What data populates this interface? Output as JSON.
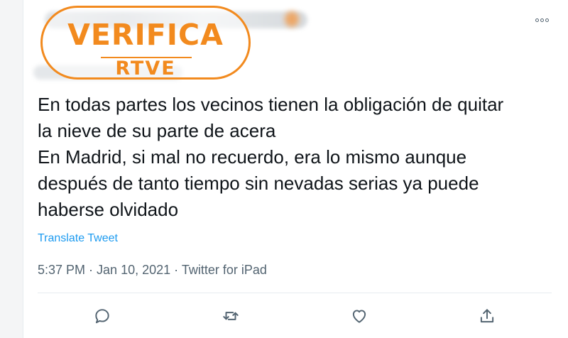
{
  "watermark": {
    "brand": "VERIFICA",
    "sub": "RTVE"
  },
  "tweet": {
    "lines": [
      "En todas partes los vecinos tienen la obligación de quitar",
      "la nieve de su parte de acera",
      "En Madrid, si mal no recuerdo, era lo mismo aunque",
      "después de tanto tiempo sin nevadas serias ya puede",
      "haberse olvidado"
    ],
    "translate_label": "Translate Tweet",
    "time": "5:37 PM",
    "separator": " · ",
    "date": "Jan 10, 2021",
    "source": "Twitter for iPad"
  },
  "icons": {
    "more": "more-horizontal-icon",
    "reply": "reply-icon",
    "retweet": "retweet-icon",
    "like": "heart-icon",
    "share": "share-icon"
  },
  "colors": {
    "watermark": "#f28a1e",
    "link": "#1d9bf0",
    "text": "#0f1419",
    "muted": "#536471"
  }
}
